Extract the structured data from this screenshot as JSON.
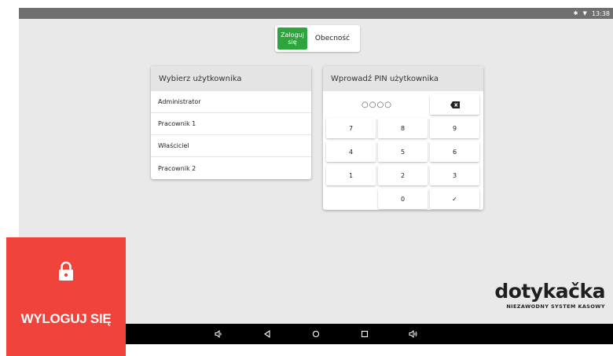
{
  "status_bar": {
    "time": "13:38",
    "bluetooth_icon": "bluetooth-icon",
    "wifi_icon": "wifi-icon"
  },
  "mode_toggle": {
    "login_label": "Zaloguj\nsię",
    "attendance_label": "Obecność",
    "active": "login",
    "active_color": "#2ea43e"
  },
  "users_panel": {
    "title": "Wybierz użytkownika",
    "items": [
      "Administrator",
      "Pracownik 1",
      "Właściciel",
      "Pracownik 2"
    ]
  },
  "pin_panel": {
    "title": "Wprowadź PIN użytkownika",
    "pin_display": "○○○○",
    "keys": [
      "7",
      "8",
      "9",
      "4",
      "5",
      "6",
      "1",
      "2",
      "3",
      "0"
    ],
    "backspace_icon": "backspace-icon",
    "confirm_label": "✓"
  },
  "brand": {
    "name": "dotykačka",
    "tagline": "NIEZAWODNY SYSTEM KASOWY"
  },
  "nav_bar": {
    "icons": [
      "volume-down-icon",
      "back-icon",
      "home-icon",
      "recents-icon",
      "volume-up-icon"
    ]
  },
  "logout_tile": {
    "label": "WYLOGUJ SIĘ",
    "icon": "lock-icon",
    "color": "#f0433b"
  }
}
